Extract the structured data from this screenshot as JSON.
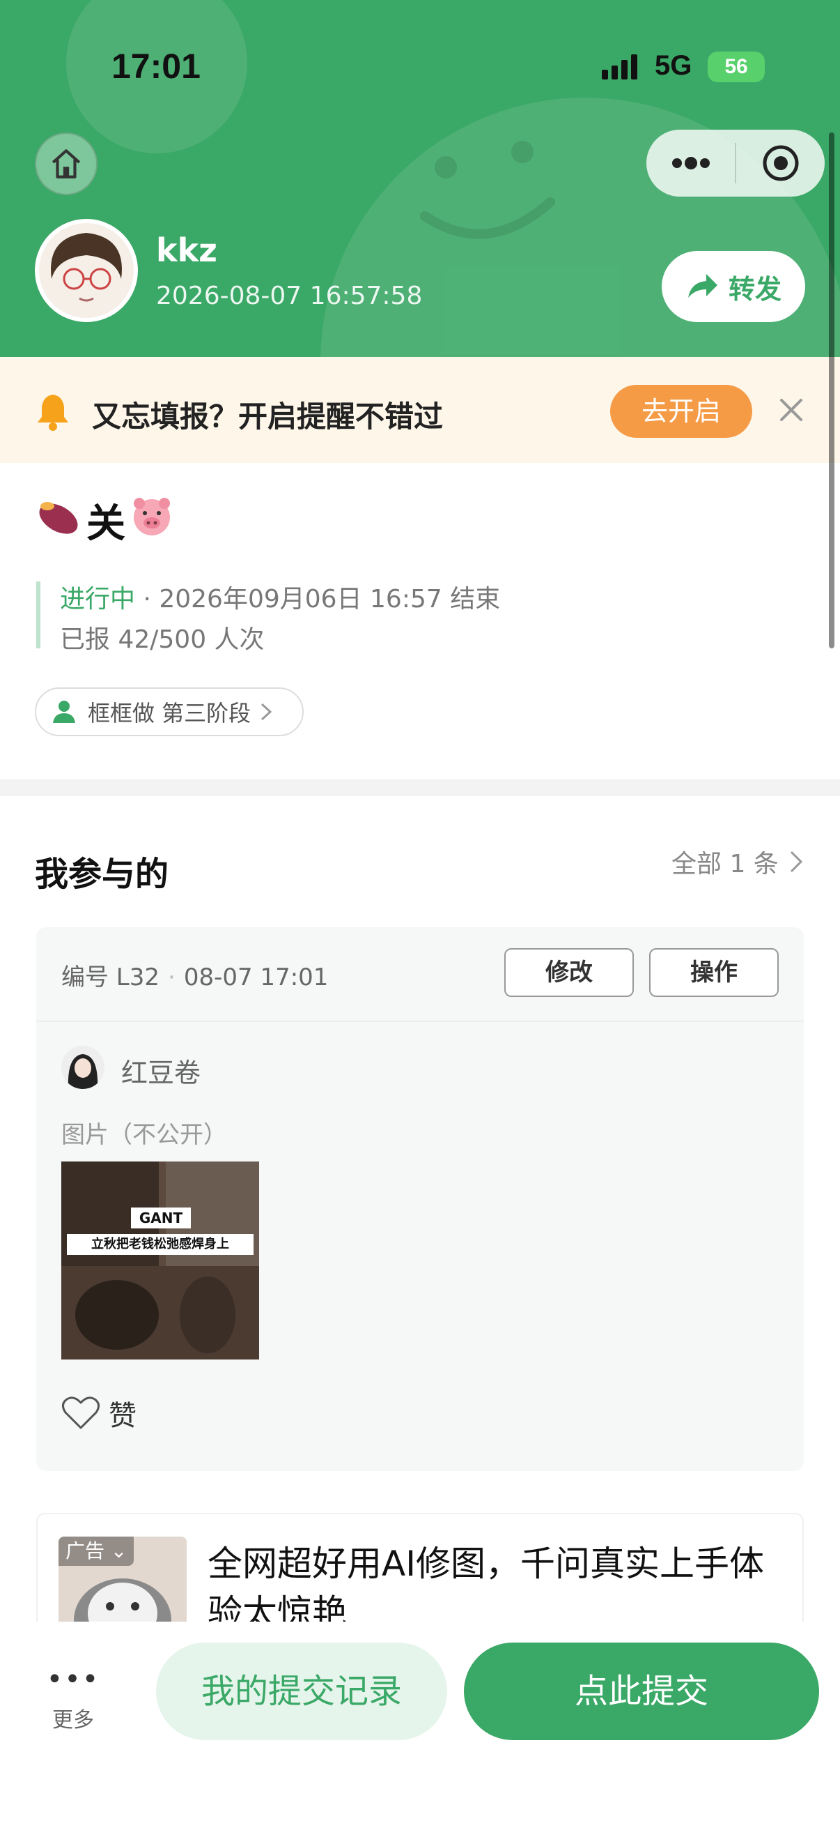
{
  "status_bar": {
    "time": "17:01",
    "network": "5G",
    "battery": "56"
  },
  "header": {
    "username": "kkz",
    "datetime": "2026-08-07 16:57:58",
    "share_label": "转发"
  },
  "reminder": {
    "text": "又忘填报？开启提醒不错过",
    "button_label": "去开启"
  },
  "activity": {
    "title": "关",
    "status": "进行中",
    "end_info": " · 2026年09月06日 16:57 结束",
    "reported": "已报 42/500 人次",
    "stage": "框框做 第三阶段"
  },
  "my_section": {
    "title": "我参与的",
    "all_label": "全部 1 条",
    "entry": {
      "code": "编号 L32",
      "time": "08-07 17:01",
      "edit_label": "修改",
      "operate_label": "操作",
      "person": "红豆卷",
      "image_label": "图片（不公开）",
      "image_text_brand": "GANT",
      "image_text_caption": "立秋把老钱松弛感焊身上",
      "like_label": "赞"
    }
  },
  "ad": {
    "tag": "广告",
    "title": "全网超好用AI修图，千问真实上手体验太惊艳"
  },
  "bottom": {
    "more_label": "更多",
    "records_label": "我的提交记录",
    "submit_label": "点此提交"
  },
  "colors": {
    "brand_green": "#3aa866",
    "warning_orange": "#f59a45"
  }
}
